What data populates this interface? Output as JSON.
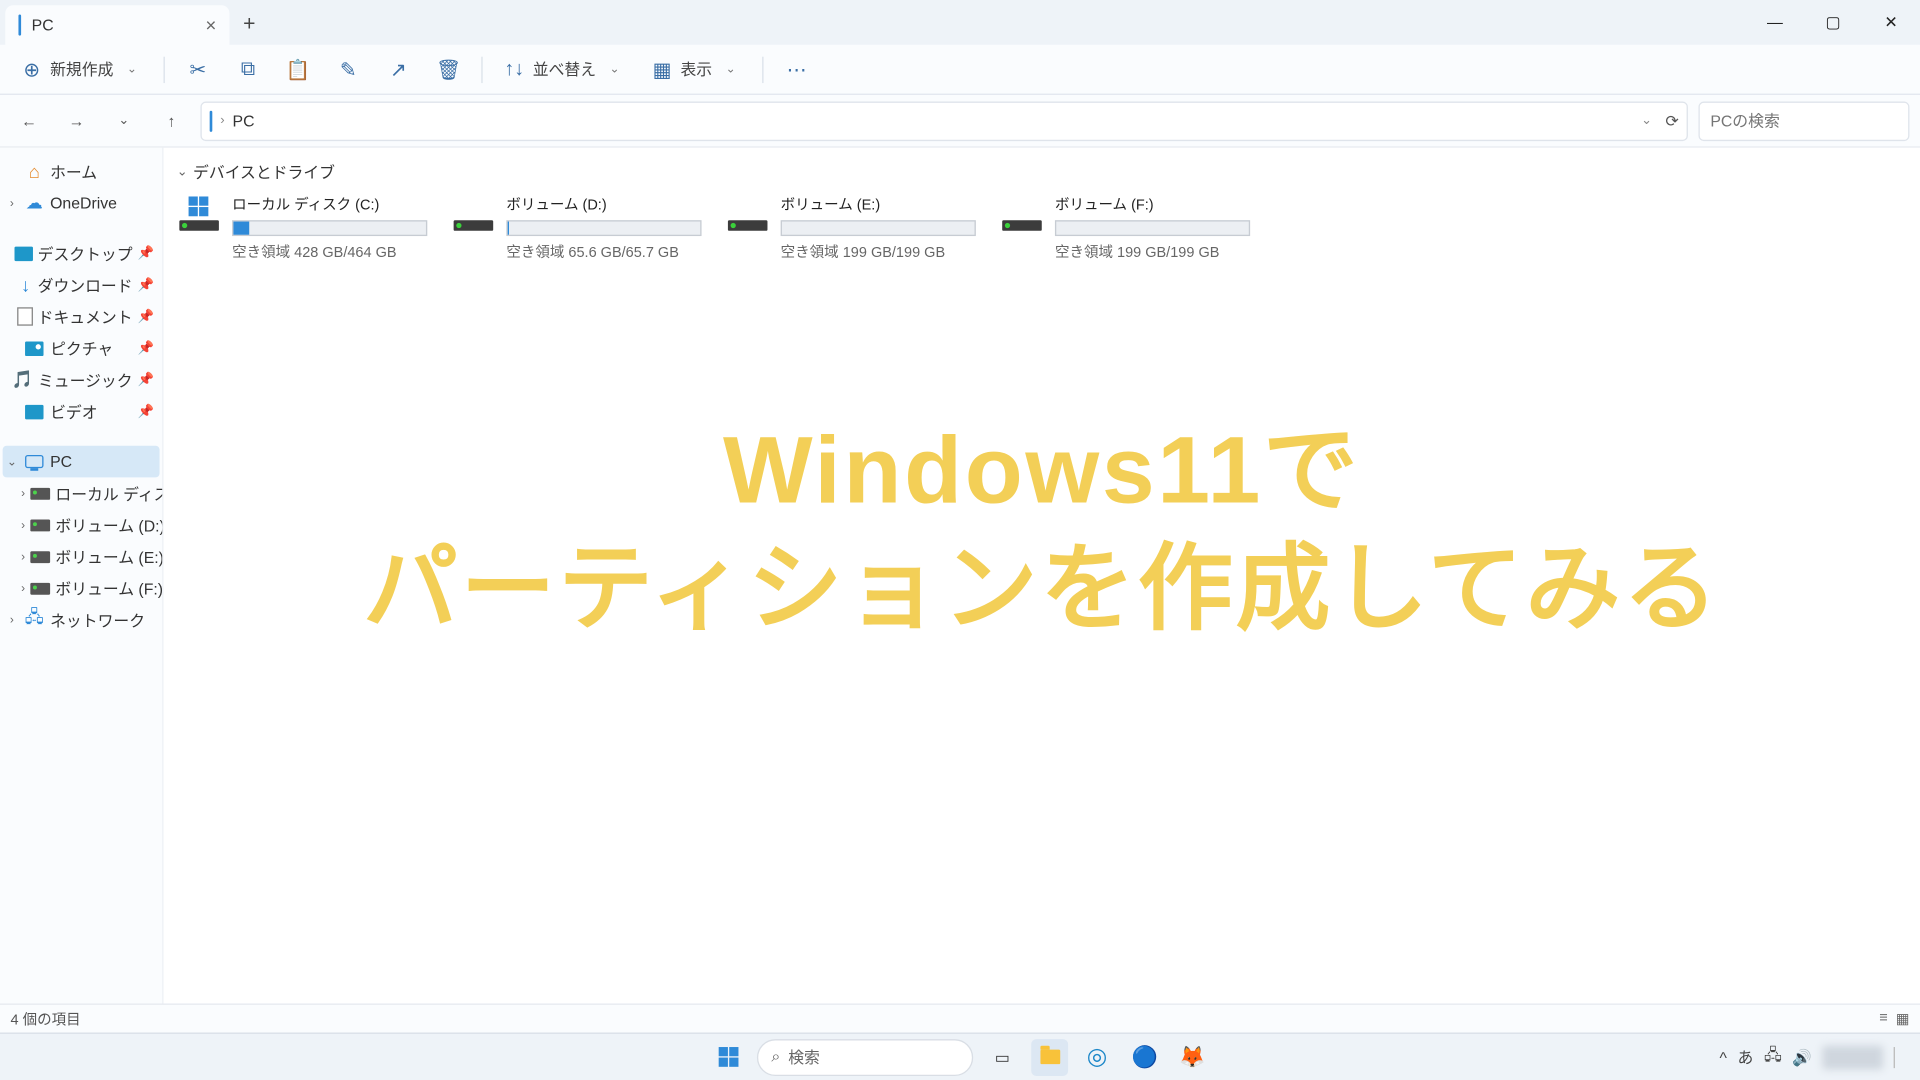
{
  "window": {
    "tab_title": "PC",
    "new_item": "新規作成",
    "sort": "並べ替え",
    "view": "表示"
  },
  "address": {
    "location": "PC",
    "search_placeholder": "PCの検索"
  },
  "sidebar": {
    "home": "ホーム",
    "onedrive": "OneDrive",
    "desktop": "デスクトップ",
    "downloads": "ダウンロード",
    "documents": "ドキュメント",
    "pictures": "ピクチャ",
    "music": "ミュージック",
    "videos": "ビデオ",
    "pc": "PC",
    "drive_c": "ローカル ディスク (C:)",
    "drive_d": "ボリューム (D:)",
    "drive_e": "ボリューム (E:)",
    "drive_f": "ボリューム (F:)",
    "network": "ネットワーク"
  },
  "content": {
    "group_title": "デバイスとドライブ",
    "drives": [
      {
        "name": "ローカル ディスク (C:)",
        "free": "空き領域 428 GB/464 GB",
        "fill_pct": 8,
        "has_winlogo": true
      },
      {
        "name": "ボリューム (D:)",
        "free": "空き領域 65.6 GB/65.7 GB",
        "fill_pct": 1,
        "has_winlogo": false
      },
      {
        "name": "ボリューム (E:)",
        "free": "空き領域 199 GB/199 GB",
        "fill_pct": 0,
        "has_winlogo": false
      },
      {
        "name": "ボリューム (F:)",
        "free": "空き領域 199 GB/199 GB",
        "fill_pct": 0,
        "has_winlogo": false
      }
    ]
  },
  "overlay": {
    "line1": "Windows11で",
    "line2": "パーティションを作成してみる"
  },
  "status": {
    "items": "4 個の項目"
  },
  "taskbar": {
    "search": "検索",
    "ime": "あ"
  }
}
